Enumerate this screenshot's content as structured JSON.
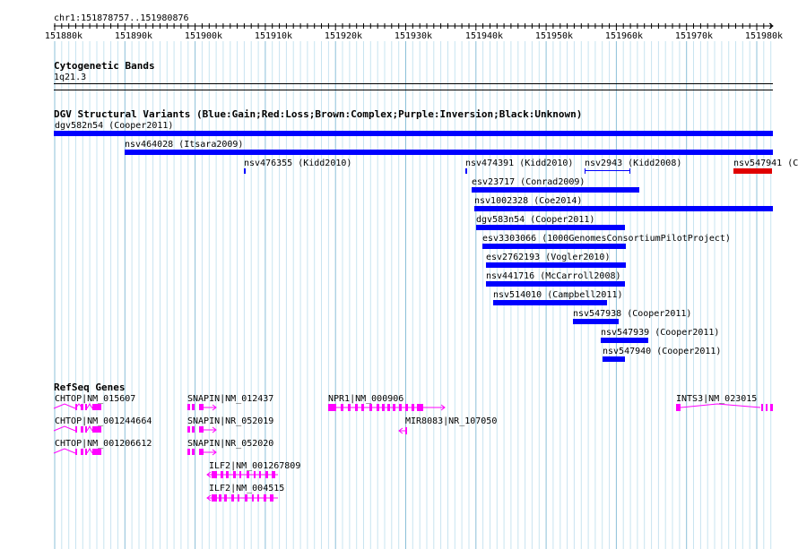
{
  "colors": {
    "gain": "#0000ff",
    "loss": "#e00000",
    "gene": "#ff00ff",
    "grid_minor": "#c8e4f0",
    "grid_major": "#8cc0d8"
  },
  "ruler": {
    "range_label": "chr1:151878757..151980876",
    "ticks": [
      "151880k",
      "151890k",
      "151900k",
      "151910k",
      "151920k",
      "151930k",
      "151940k",
      "151950k",
      "151960k",
      "151970k",
      "151980k"
    ]
  },
  "cytobands": {
    "title": "Cytogenetic Bands",
    "band": "1q21.3"
  },
  "dgv": {
    "title": "DGV Structural Variants (Blue:Gain;Red:Loss;Brown:Complex;Purple:Inversion;Black:Unknown)",
    "variants": [
      {
        "label": "dgv582n54 (Cooper2011)",
        "type": "gain"
      },
      {
        "label": "nsv464028 (Itsara2009)",
        "type": "gain"
      },
      {
        "label": "nsv476355 (Kidd2010)",
        "type": "gain"
      },
      {
        "label": "nsv474391 (Kidd2010)",
        "type": "gain"
      },
      {
        "label": "nsv2943 (Kidd2008)",
        "type": "inversion-span"
      },
      {
        "label": "nsv547941 (C",
        "type": "loss"
      },
      {
        "label": "esv23717 (Conrad2009)",
        "type": "gain"
      },
      {
        "label": "nsv1002328 (Coe2014)",
        "type": "gain"
      },
      {
        "label": "dgv583n54 (Cooper2011)",
        "type": "gain"
      },
      {
        "label": "esv3303066 (1000GenomesConsortiumPilotProject)",
        "type": "gain"
      },
      {
        "label": "esv2762193 (Vogler2010)",
        "type": "gain"
      },
      {
        "label": "nsv441716 (McCarroll2008)",
        "type": "gain"
      },
      {
        "label": "nsv514010 (Campbell2011)",
        "type": "gain"
      },
      {
        "label": "nsv547938 (Cooper2011)",
        "type": "gain"
      },
      {
        "label": "nsv547939 (Cooper2011)",
        "type": "gain"
      },
      {
        "label": "nsv547940 (Cooper2011)",
        "type": "gain"
      }
    ]
  },
  "refseq": {
    "title": "RefSeq Genes",
    "genes": [
      {
        "label": "CHTOP|NM_015607"
      },
      {
        "label": "CHTOP|NM_001244664"
      },
      {
        "label": "CHTOP|NM_001206612"
      },
      {
        "label": "SNAPIN|NM_012437"
      },
      {
        "label": "SNAPIN|NR_052019"
      },
      {
        "label": "SNAPIN|NR_052020"
      },
      {
        "label": "ILF2|NM_001267809"
      },
      {
        "label": "ILF2|NM_004515"
      },
      {
        "label": "NPR1|NM_000906"
      },
      {
        "label": "MIR8083|NR_107050"
      },
      {
        "label": "INTS3|NM_023015"
      }
    ]
  }
}
